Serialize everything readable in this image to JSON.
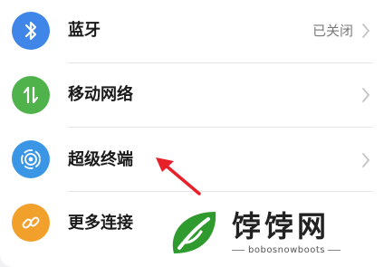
{
  "settings": {
    "items": [
      {
        "label": "蓝牙",
        "value": "已关闭",
        "icon": "bluetooth-icon",
        "color": "#3f86e8"
      },
      {
        "label": "移动网络",
        "value": "",
        "icon": "mobile-network-icon",
        "color": "#4fb24b"
      },
      {
        "label": "超级终端",
        "value": "",
        "icon": "super-device-icon",
        "color": "#3b97e6"
      },
      {
        "label": "更多连接",
        "value": "",
        "icon": "more-connections-icon",
        "color": "#f2a02c"
      }
    ]
  },
  "watermark": {
    "title": "饽饽网",
    "subtitle": "bobosnowboots"
  },
  "colors": {
    "arrow": "#e8202a",
    "logo_green": "#2f9b2f"
  }
}
